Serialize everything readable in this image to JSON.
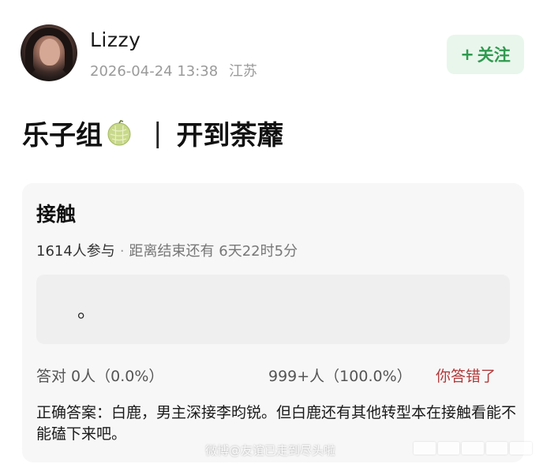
{
  "post": {
    "author": {
      "name": "Lizzy",
      "timestamp": "2026-04-24 13:38",
      "location": "江苏"
    },
    "follow_button": {
      "icon": "+",
      "label": "关注"
    },
    "title_left": "乐子组",
    "title_emoji": "melon-emoji",
    "title_separator": "|",
    "title_right": "开到荼蘼"
  },
  "poll": {
    "title": "接触",
    "participants": "1614人参与",
    "separator": "·",
    "remaining": "距离结束还有 6天22时5分",
    "option_text": "。",
    "correct_count": "答对 0人（0.0%）",
    "wrong_count": "999+人（100.0%）",
    "result_label": "你答错了",
    "answer": "正确答案：白鹿，男主深接李昀锐。但白鹿还有其他转型本在接触看能不能磕下来吧。"
  },
  "watermark": {
    "text": "微博@友谊已走到尽头啦"
  },
  "colors": {
    "follow_bg": "#e9f6ec",
    "follow_text": "#2f9a4f",
    "wrong_text": "#b23a3a",
    "card_bg": "#f7f7f7"
  }
}
